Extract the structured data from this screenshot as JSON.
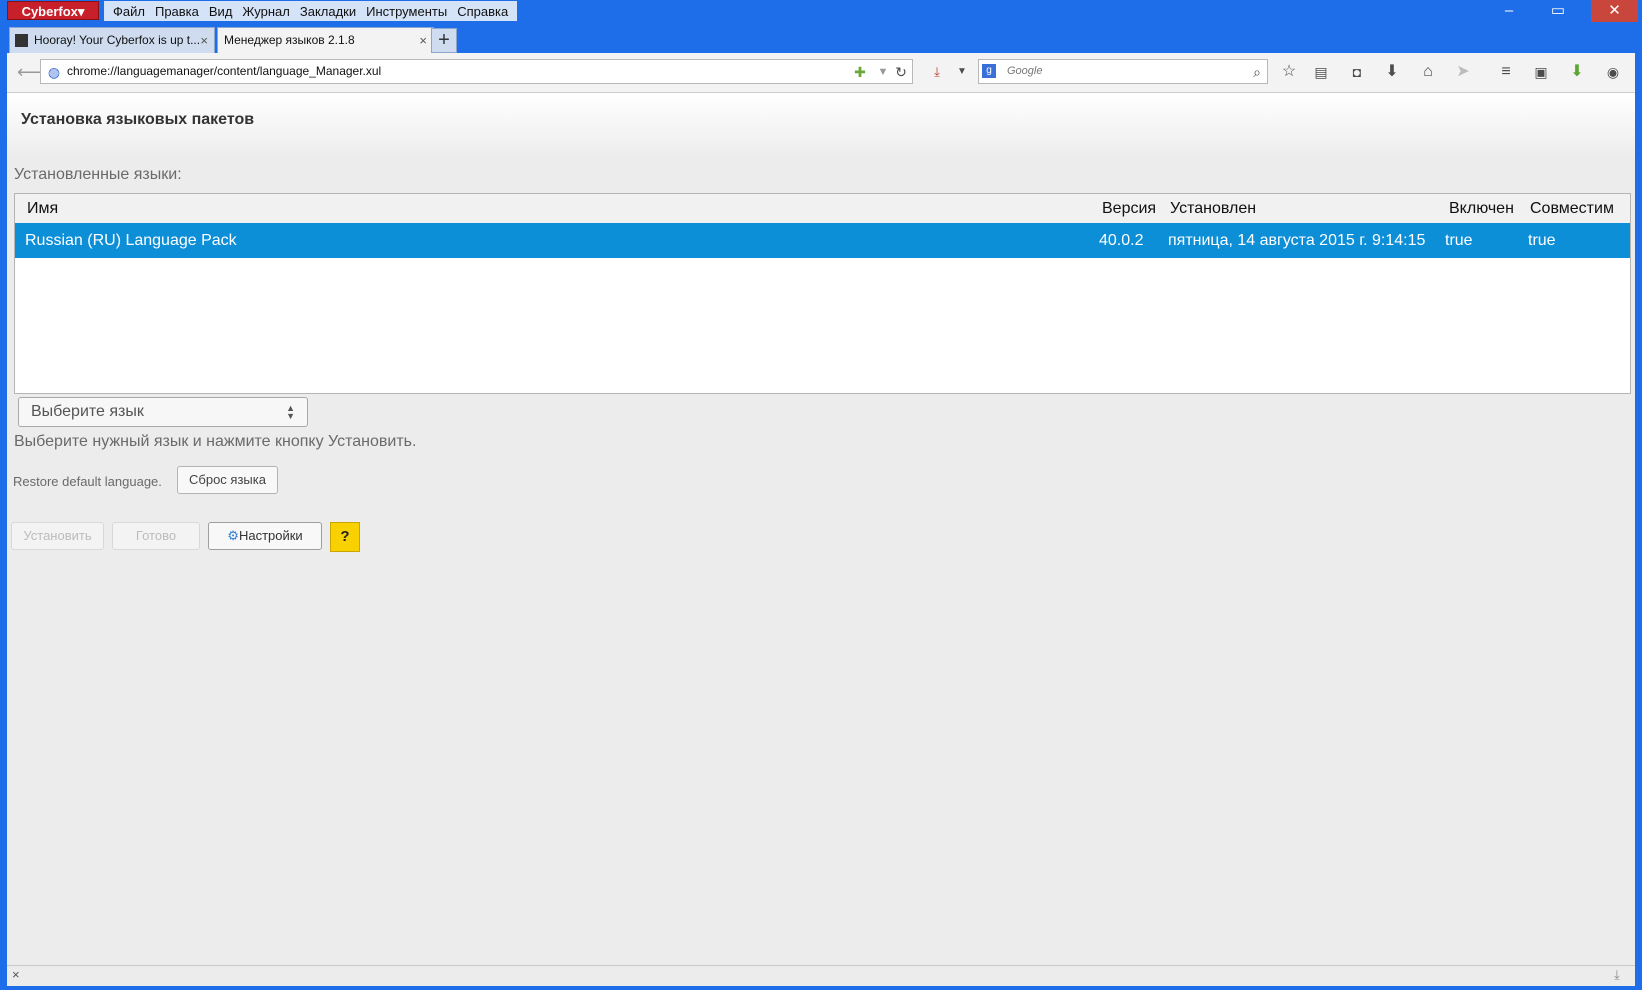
{
  "window": {
    "app_button": "Cyberfox▾",
    "menu": [
      "Файл",
      "Правка",
      "Вид",
      "Журнал",
      "Закладки",
      "Инструменты",
      "Справка"
    ],
    "minimize": "–",
    "maximize": "▭",
    "close": "✕"
  },
  "tabs": [
    {
      "label": "Hooray! Your Cyberfox is up t...",
      "close": "×"
    },
    {
      "label": "Менеджер языков 2.1.8",
      "close": "×"
    }
  ],
  "new_tab": "+",
  "nav": {
    "url": "chrome://languagemanager/content/language_Manager.xul",
    "search_placeholder": "Google"
  },
  "page": {
    "heading": "Установка языковых пакетов",
    "installed_label": "Установленные языки:",
    "table": {
      "columns": [
        "Имя",
        "Версия",
        "Установлен",
        "Включен",
        "Совместим"
      ],
      "rows": [
        {
          "name": "Russian (RU) Language Pack",
          "version": "40.0.2",
          "installed": "пятница, 14 августа 2015 г. 9:14:15",
          "enabled": "true",
          "compatible": "true"
        }
      ]
    },
    "language_select": "Выберите язык",
    "hint": "Выберите нужный язык и нажмите кнопку Установить.",
    "restore_label": "Restore default language.",
    "reset_button": "Сброс языка",
    "install_button": "Установить",
    "done_button": "Готово",
    "settings_button": "Настройки",
    "help_button": "?"
  },
  "status": {
    "close": "×"
  },
  "colors": {
    "titlebar": "#1d6ee8",
    "selected_row": "#0d8fd8",
    "help": "#f9d000",
    "app_button": "#c8202a"
  }
}
